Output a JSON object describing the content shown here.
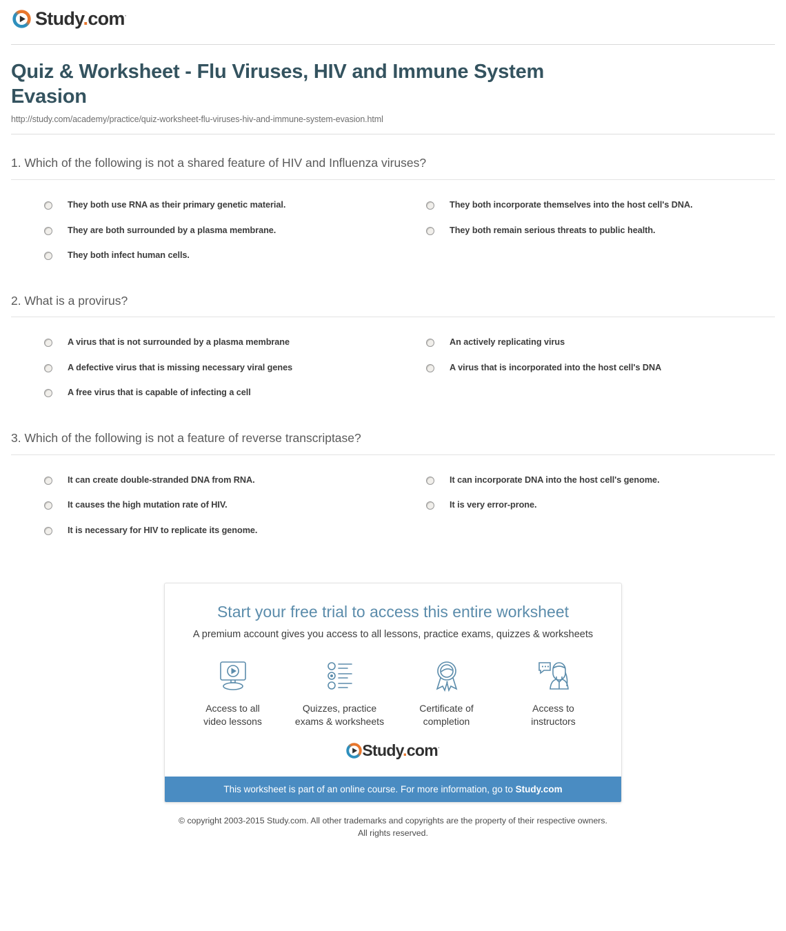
{
  "brand": {
    "name_main": "Study",
    "name_dot": ".",
    "name_tld": "com",
    "trademark": "·",
    "logo_icon": "play-circle-icon",
    "colors": {
      "logo_blue": "#2e8fbd",
      "logo_orange": "#e8762c",
      "title": "#34535f",
      "promo_title": "#5b8cab",
      "promo_bar": "#4a8cc2"
    }
  },
  "header": {
    "title": "Quiz & Worksheet - Flu Viruses, HIV and Immune System Evasion",
    "url": "http://study.com/academy/practice/quiz-worksheet-flu-viruses-hiv-and-immune-system-evasion.html"
  },
  "questions": [
    {
      "text": "1. Which of the following is not a shared feature of HIV and Influenza viruses?",
      "options": [
        "They both use RNA as their primary genetic material.",
        "They both incorporate themselves into the host cell's DNA.",
        "They are both surrounded by a plasma membrane.",
        "They both remain serious threats to public health.",
        "They both infect human cells."
      ]
    },
    {
      "text": "2. What is a provirus?",
      "options": [
        "A virus that is not surrounded by a plasma membrane",
        "An actively replicating virus",
        "A defective virus that is missing necessary viral genes",
        "A virus that is incorporated into the host cell's DNA",
        "A free virus that is capable of infecting a cell"
      ]
    },
    {
      "text": "3. Which of the following is not a feature of reverse transcriptase?",
      "options": [
        "It can create double-stranded DNA from RNA.",
        "It can incorporate DNA into the host cell's genome.",
        "It causes the high mutation rate of HIV.",
        "It is very error-prone.",
        "It is necessary for HIV to replicate its genome."
      ]
    }
  ],
  "promo": {
    "title": "Start your free trial to access this entire worksheet",
    "subtitle": "A premium account gives you access to all lessons, practice exams, quizzes & worksheets",
    "features": [
      {
        "icon": "monitor-play-icon",
        "label": "Access to all\nvideo lessons",
        "line1": "Access to all",
        "line2": "video lessons"
      },
      {
        "icon": "quiz-list-icon",
        "label": "Quizzes, practice\nexams & worksheets",
        "line1": "Quizzes, practice",
        "line2": "exams & worksheets"
      },
      {
        "icon": "award-ribbon-icon",
        "label": "Certificate of\ncompletion",
        "line1": "Certificate of",
        "line2": "completion"
      },
      {
        "icon": "instructor-chat-icon",
        "label": "Access to\ninstructors",
        "line1": "Access to",
        "line2": "instructors"
      }
    ],
    "bar_text": "This worksheet is part of an online course. For more information, go to ",
    "bar_link": "Study.com"
  },
  "footer": {
    "line1": "© copyright 2003-2015 Study.com. All other trademarks and copyrights are the property of their respective owners.",
    "line2": "All rights reserved."
  }
}
